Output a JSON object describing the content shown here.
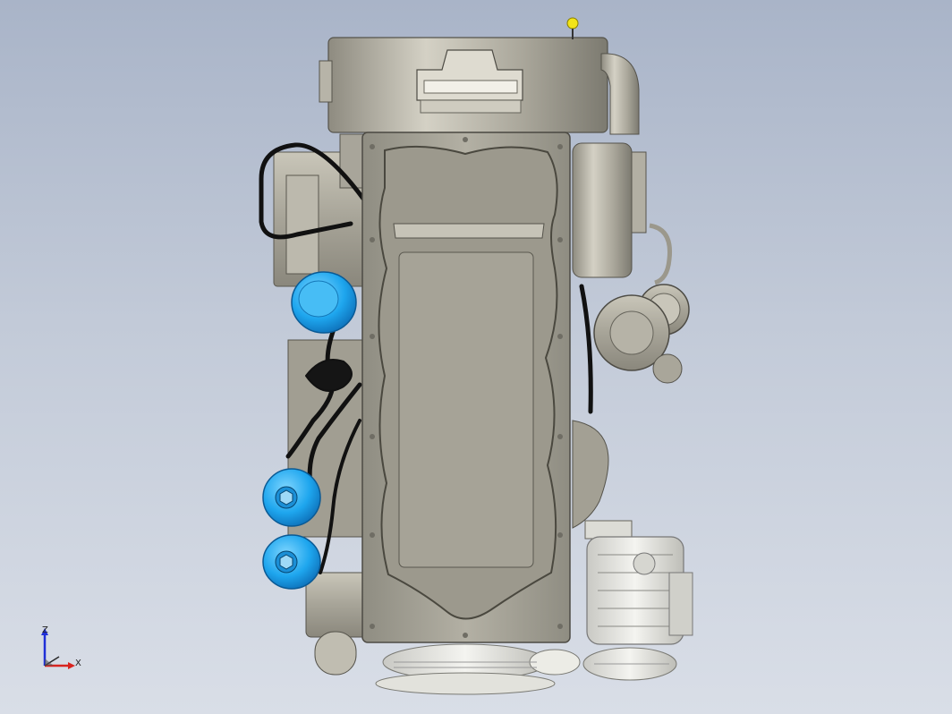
{
  "viewport": {
    "background_top": "#a9b4c8",
    "background_bottom": "#d9dee7",
    "model": "engine-assembly"
  },
  "triad": {
    "z_label": "Z",
    "x_label": "X",
    "z_color": "#1f2fd8",
    "x_color": "#d8241f"
  },
  "colors": {
    "metal": "#b8b5a8",
    "filters": "#22aaee",
    "hoses": "#101010",
    "handle": "#f2e418"
  }
}
